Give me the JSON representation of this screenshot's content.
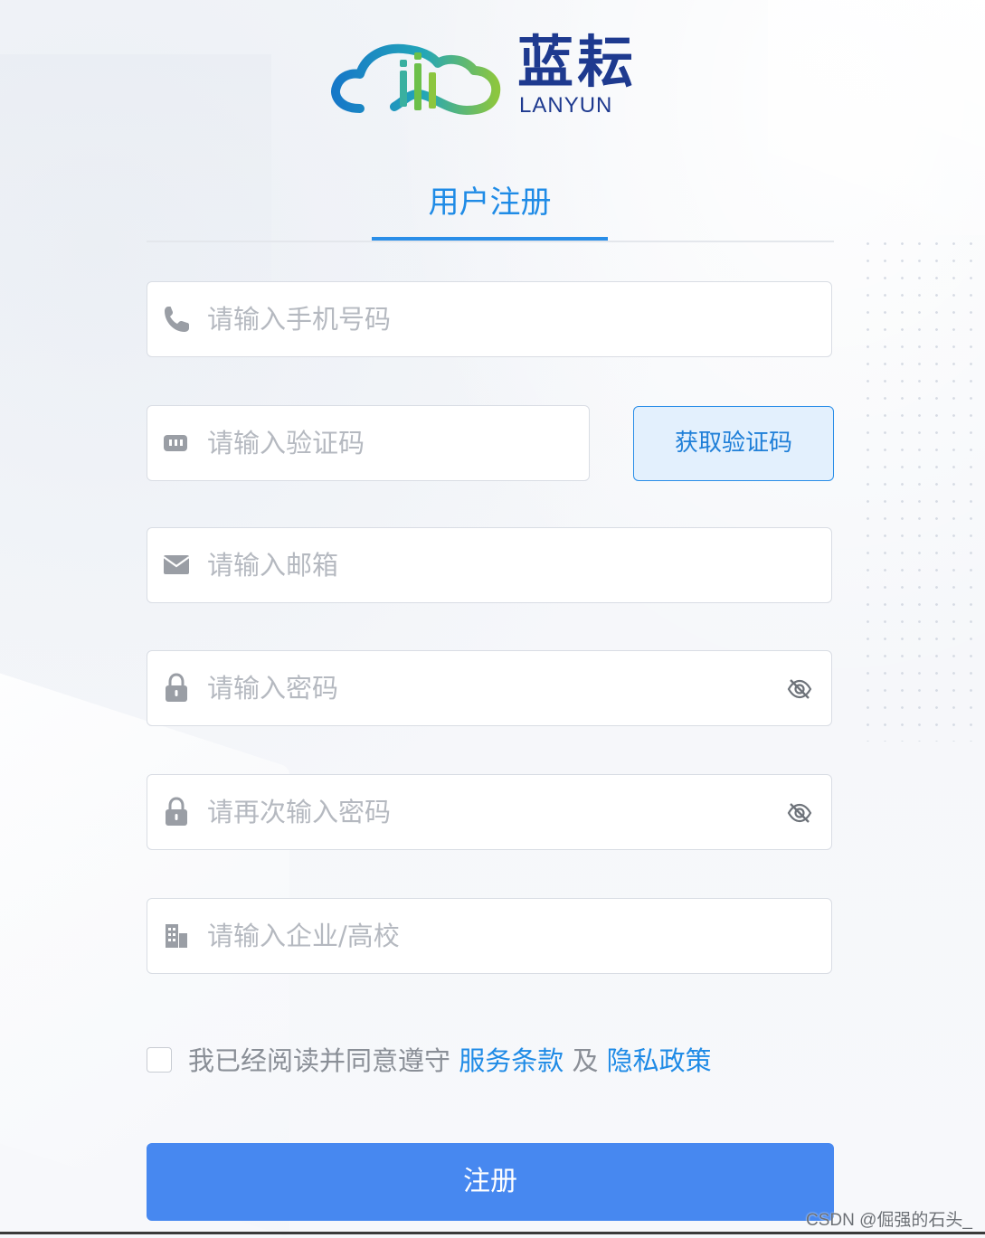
{
  "logo": {
    "name_cn": "蓝耘",
    "name_en": "LANYUN"
  },
  "tab": {
    "label": "用户注册"
  },
  "form": {
    "phone": {
      "placeholder": "请输入手机号码",
      "icon": "phone-icon"
    },
    "code": {
      "placeholder": "请输入验证码",
      "icon": "message-code-icon"
    },
    "get_code_button": "获取验证码",
    "email": {
      "placeholder": "请输入邮箱",
      "icon": "mail-icon"
    },
    "password": {
      "placeholder": "请输入密码",
      "icon": "lock-icon",
      "toggle_icon": "eye-off-icon"
    },
    "password_confirm": {
      "placeholder": "请再次输入密码",
      "icon": "lock-icon",
      "toggle_icon": "eye-off-icon"
    },
    "organization": {
      "placeholder": "请输入企业/高校",
      "icon": "building-icon"
    }
  },
  "agreement": {
    "checked": false,
    "prefix": "我已经阅读并同意遵守 ",
    "terms_link": "服务条款",
    "joiner": " 及 ",
    "privacy_link": "隐私政策"
  },
  "submit_label": "注册",
  "watermark": "CSDN @倔强的石头_",
  "colors": {
    "primary": "#2a8ee8",
    "button": "#4788f0",
    "brand": "#1e3a8f"
  }
}
